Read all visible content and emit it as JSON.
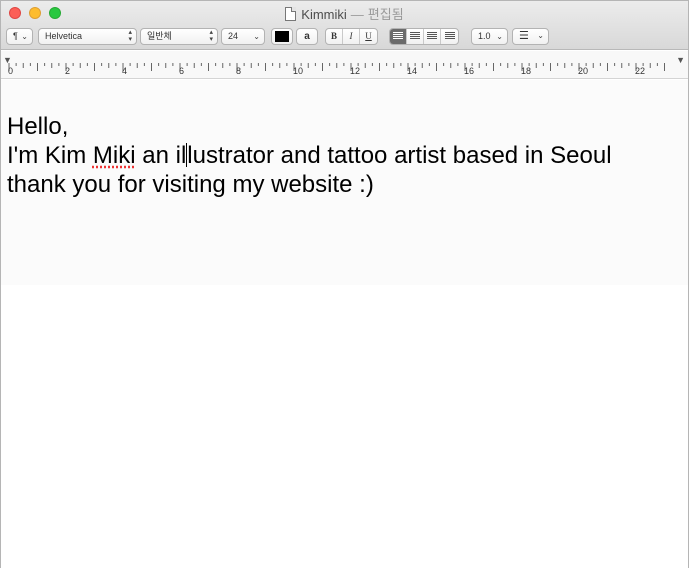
{
  "window": {
    "title": "Kimmiki",
    "separator": "—",
    "status": "편집됨"
  },
  "toolbar": {
    "paragraph_style": "¶",
    "font_family": "Helvetica",
    "font_style": "일반체",
    "font_size": "24",
    "text_color": "#000000",
    "highlight_label": "a",
    "bold_label": "B",
    "italic_label": "I",
    "underline_label": "U",
    "line_spacing": "1.0",
    "list_icon": "list-bullet-icon"
  },
  "ruler": {
    "numbers": [
      "0",
      "2",
      "4",
      "6",
      "8",
      "10",
      "12",
      "14",
      "16",
      "18",
      "20",
      "22"
    ]
  },
  "document": {
    "line1": "Hello,",
    "line2_a": "I'm Kim ",
    "line2_misspelled": "Miki",
    "line2_b": " an il",
    "line2_c": "lustrator and tattoo artist based in Seoul",
    "line3": "thank you for visiting my website  :)"
  }
}
